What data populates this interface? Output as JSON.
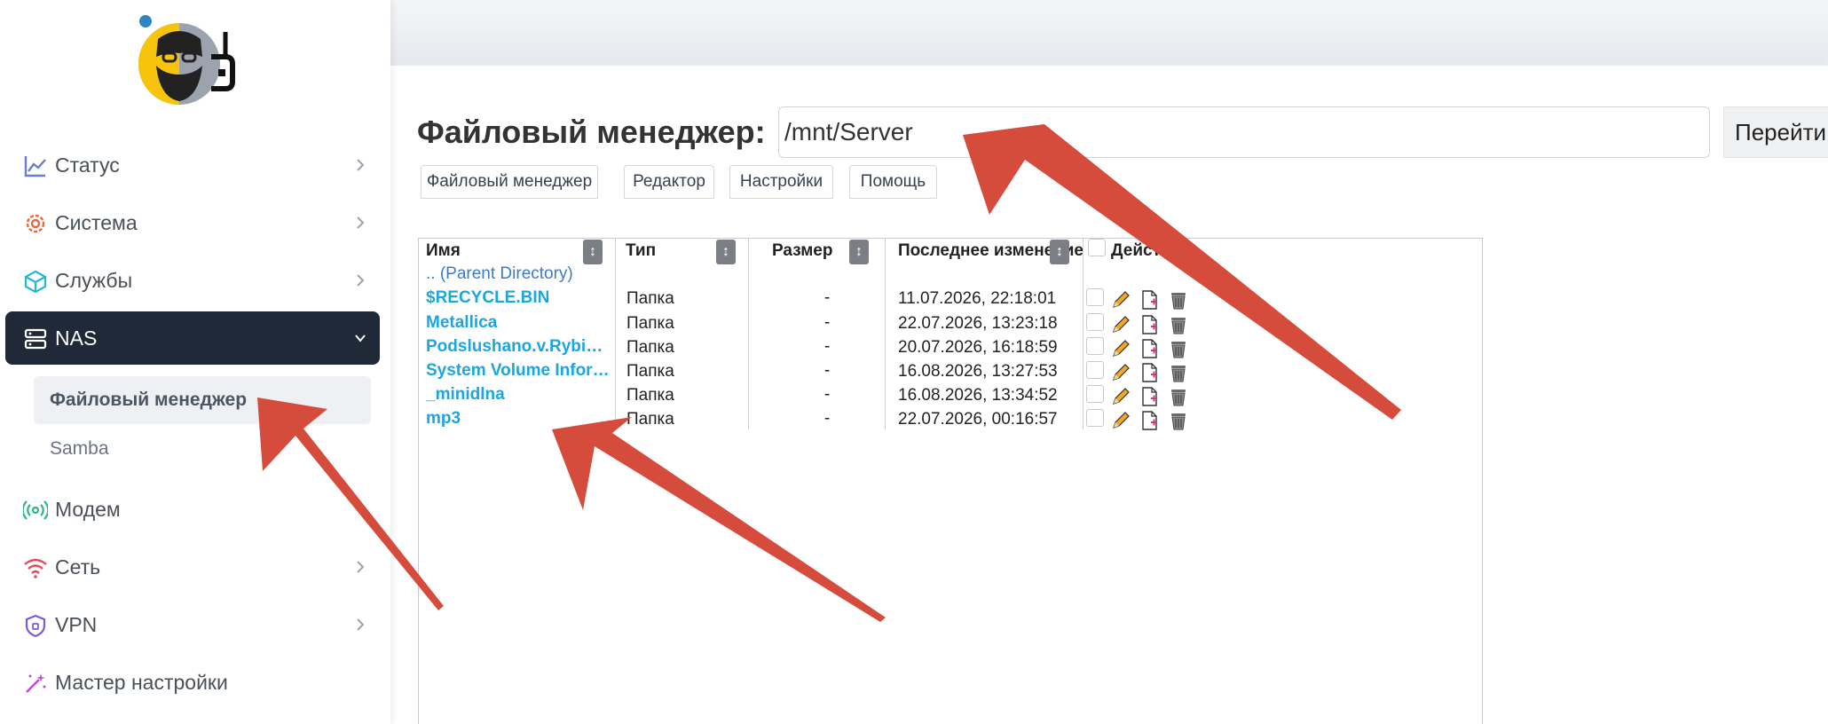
{
  "sidebar": {
    "items": [
      {
        "label": "Статус",
        "icon": "chart-line-icon"
      },
      {
        "label": "Система",
        "icon": "gear-icon"
      },
      {
        "label": "Службы",
        "icon": "cube-icon"
      },
      {
        "label": "NAS",
        "icon": "server-icon"
      },
      {
        "label": "Модем",
        "icon": "broadcast-icon"
      },
      {
        "label": "Сеть",
        "icon": "wifi-icon"
      },
      {
        "label": "VPN",
        "icon": "shield-icon"
      },
      {
        "label": "Мастер настройки",
        "icon": "magic-wand-icon"
      }
    ],
    "nas_sub": [
      {
        "label": "Файловый менеджер"
      },
      {
        "label": "Samba"
      }
    ]
  },
  "file_manager": {
    "title": "Файловый менеджер:",
    "path": "/mnt/Server",
    "go_label": "Перейти",
    "tabs": [
      "Файловый менеджер",
      "Редактор",
      "Настройки",
      "Помощь"
    ],
    "columns": [
      "Имя",
      "Тип",
      "Размер",
      "Последнее изменение",
      "Действия"
    ],
    "parent_link": ".. (Parent Directory)",
    "rows": [
      {
        "name": "$RECYCLE.BIN",
        "type": "Папка",
        "size": "-",
        "modified": "11.07.2026, 22:18:01"
      },
      {
        "name": "Metallica",
        "type": "Папка",
        "size": "-",
        "modified": "22.07.2026, 13:23:18"
      },
      {
        "name": "Podslushano.v.Rybinske",
        "type": "Папка",
        "size": "-",
        "modified": "20.07.2026, 16:18:59"
      },
      {
        "name": "System Volume Information",
        "type": "Папка",
        "size": "-",
        "modified": "16.08.2026, 13:27:53"
      },
      {
        "name": "_minidlna",
        "type": "Папка",
        "size": "-",
        "modified": "16.08.2026, 13:34:52"
      },
      {
        "name": "mp3",
        "type": "Папка",
        "size": "-",
        "modified": "22.07.2026, 00:16:57"
      }
    ]
  },
  "colors": {
    "accent_active": "#1f2937",
    "link": "#1ba6e0",
    "arrow": "#d54c3c"
  }
}
